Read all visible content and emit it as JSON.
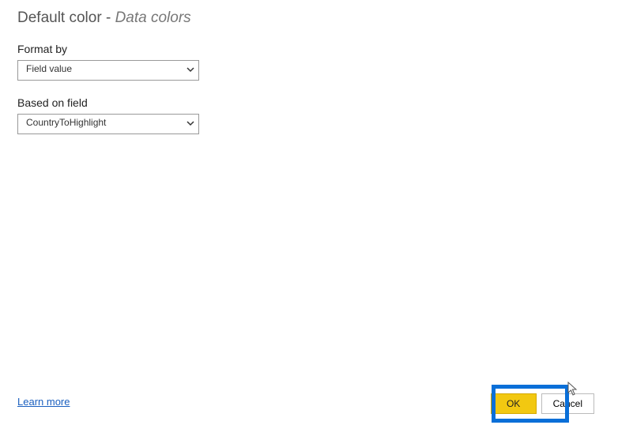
{
  "title": {
    "main": "Default color",
    "separator": " - ",
    "subtitle": "Data colors"
  },
  "fields": {
    "format_by": {
      "label": "Format by",
      "value": "Field value"
    },
    "based_on": {
      "label": "Based on field",
      "value": "CountryToHighlight"
    }
  },
  "footer": {
    "learn_more": "Learn more",
    "ok": "OK",
    "cancel": "Cancel"
  }
}
